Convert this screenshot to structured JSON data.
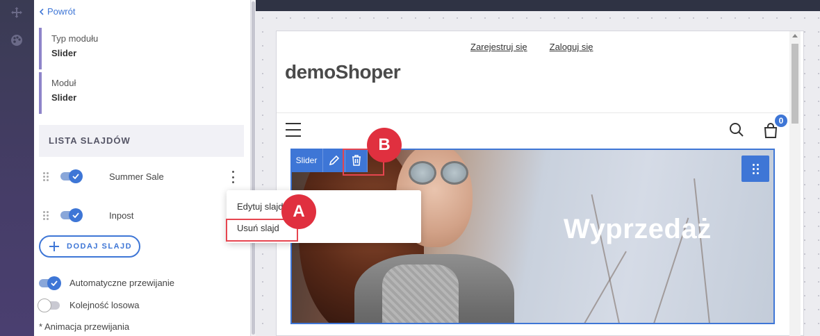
{
  "panel": {
    "back_label": "Powrót",
    "module_type_label": "Typ modułu",
    "module_type_value": "Slider",
    "module_label": "Moduł",
    "module_value": "Slider",
    "slides_header": "LISTA SLAJDÓW",
    "slides": [
      {
        "name": "Summer Sale",
        "enabled": true
      },
      {
        "name": "Inpost",
        "enabled": true
      }
    ],
    "add_slide_label": "DODAJ SLAJD",
    "auto_scroll_label": "Automatyczne przewijanie",
    "auto_scroll_on": true,
    "random_order_label": "Kolejność losowa",
    "random_order_on": false,
    "animation_label": "* Animacja przewijania"
  },
  "context_menu": {
    "edit_label": "Edytuj slajd",
    "delete_label": "Usuń slajd"
  },
  "annotations": {
    "a": "A",
    "b": "B"
  },
  "preview": {
    "register_link": "Zarejestruj się",
    "login_link": "Zaloguj się",
    "logo": "demoShoper",
    "cart_count": "0",
    "slider_label": "Slider",
    "slide_headline": "Wyprzedaż"
  },
  "colors": {
    "accent": "#3e76d6",
    "highlight": "#e6454f",
    "badge": "#e0303f",
    "rail": "#3a3b53",
    "panel_stripe": "#8e84c9"
  }
}
